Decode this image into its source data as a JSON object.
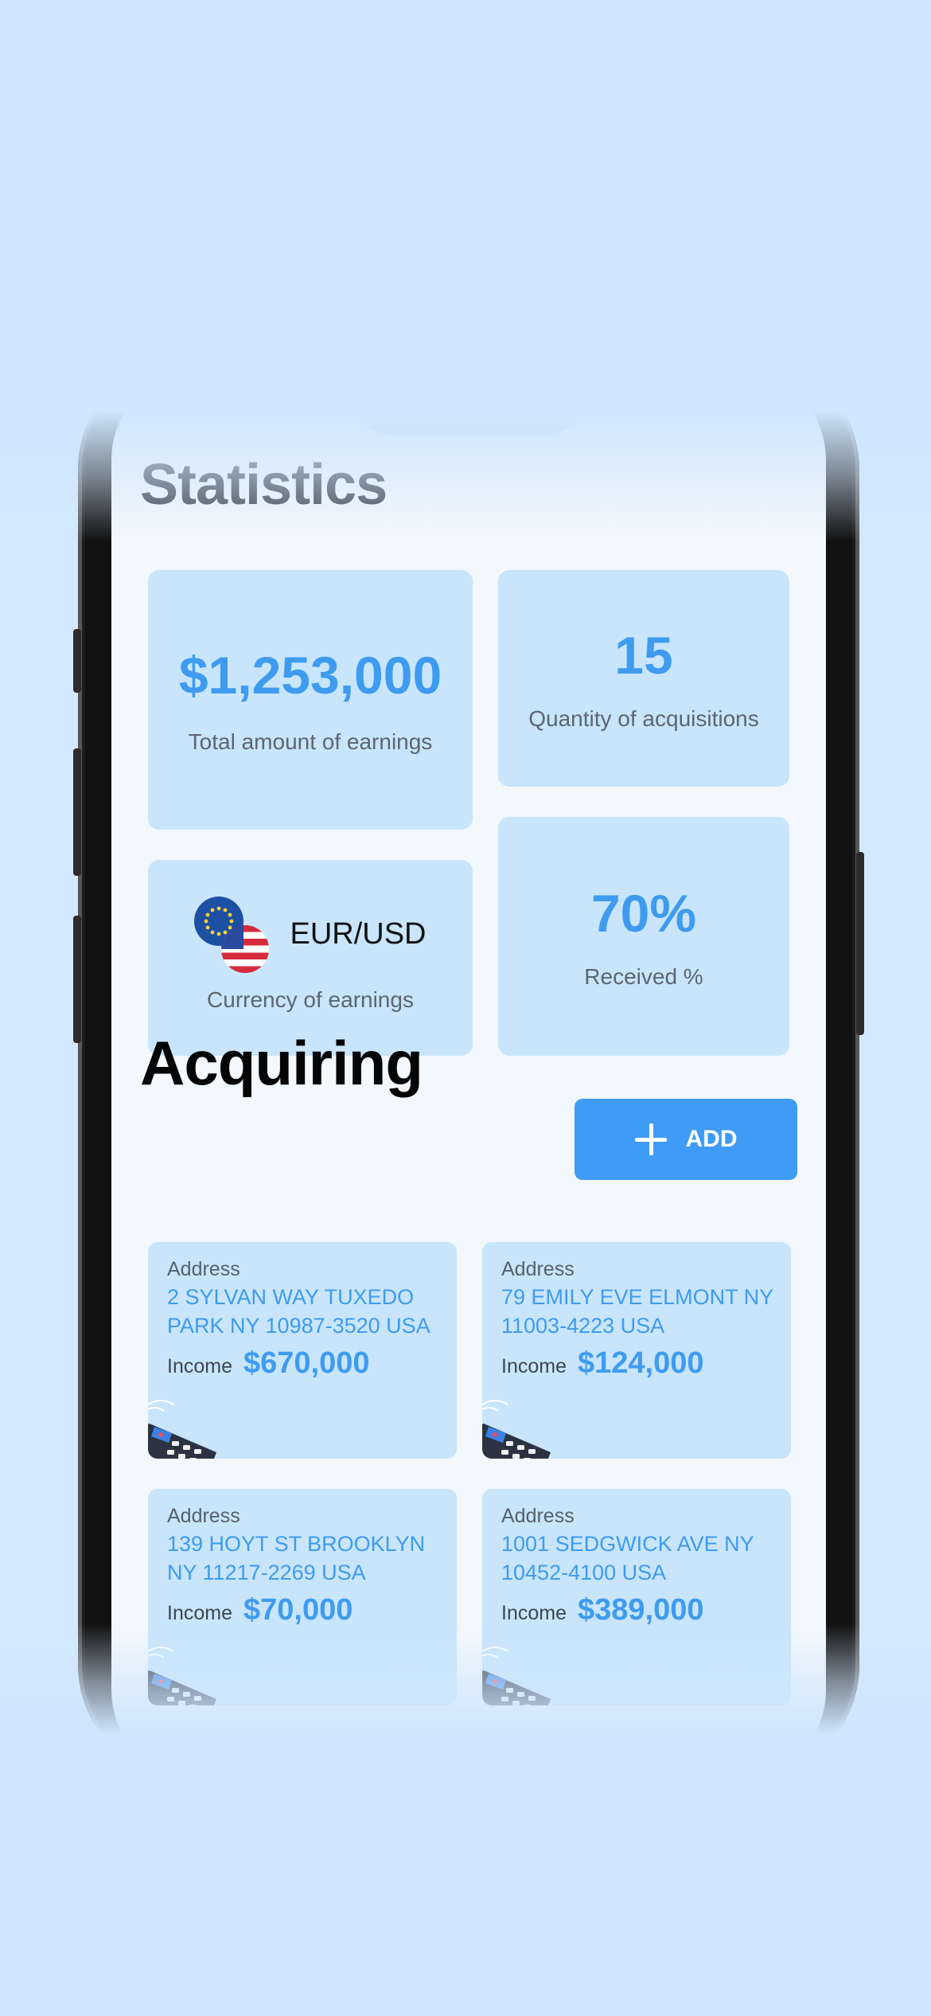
{
  "statistics": {
    "title": "Statistics",
    "total_earnings": {
      "value": "$1,253,000",
      "label": "Total amount of earnings"
    },
    "acquisitions": {
      "value": "15",
      "label": "Quantity of acquisitions"
    },
    "currency": {
      "value": "EUR/USD",
      "label": "Currency of earnings",
      "icons": [
        "eu-flag-icon",
        "us-flag-icon"
      ]
    },
    "received": {
      "value": "70%",
      "label": "Received %"
    }
  },
  "acquiring": {
    "title": "Acquiring",
    "add_button": {
      "label": "ADD",
      "icon": "plus-icon"
    },
    "address_label": "Address",
    "income_label": "Income",
    "items": [
      {
        "address": "2 SYLVAN WAY TUXEDO PARK NY 10987-3520 USA",
        "income": "$670,000"
      },
      {
        "address": "79 EMILY EVE ELMONT NY 11003-4223 USA",
        "income": "$124,000"
      },
      {
        "address": "139 HOYT ST BROOKLYN NY 11217-2269 USA",
        "income": "$70,000"
      },
      {
        "address": "1001 SEDGWICK AVE NY 10452-4100 USA",
        "income": "$389,000"
      }
    ]
  },
  "colors": {
    "accent": "#3e9bf0",
    "card_background": "#c8e5fc",
    "page_background": "#d3e8fc"
  }
}
